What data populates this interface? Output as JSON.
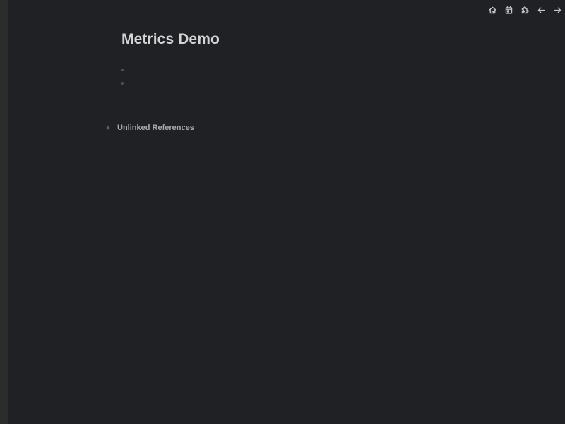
{
  "toolbar": {
    "icons": [
      "home-icon",
      "calendar-icon",
      "puzzle-icon",
      "arrow-left-icon",
      "arrow-right-icon"
    ]
  },
  "page": {
    "title": "Metrics Demo",
    "blocks": [
      "",
      ""
    ]
  },
  "references": {
    "unlinked_label": "Unlinked References"
  },
  "colors": {
    "background": "#202124",
    "sidebar": "#2b2c2b",
    "title": "#d4d4d4",
    "icon": "#c7c7c7"
  }
}
